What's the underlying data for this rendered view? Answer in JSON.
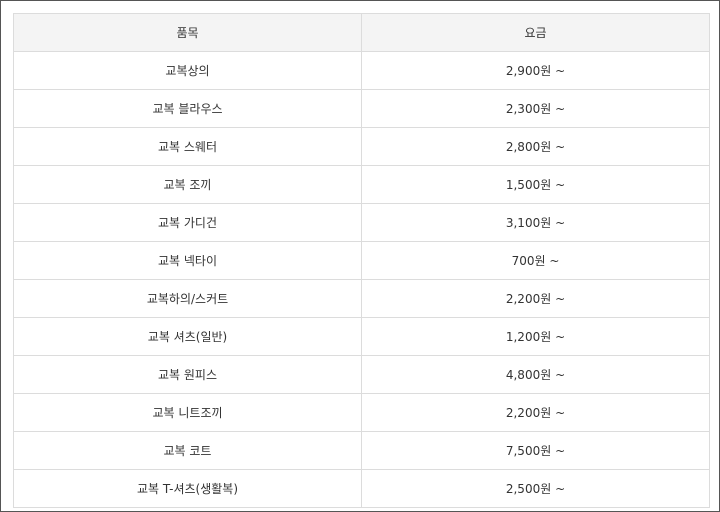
{
  "table": {
    "headers": {
      "item": "품목",
      "price": "요금"
    },
    "rows": [
      {
        "item": "교복상의",
        "price": "2,900원 ~"
      },
      {
        "item": "교복 블라우스",
        "price": "2,300원 ~"
      },
      {
        "item": "교복 스웨터",
        "price": "2,800원 ~"
      },
      {
        "item": "교복 조끼",
        "price": "1,500원 ~"
      },
      {
        "item": "교복 가디건",
        "price": "3,100원 ~"
      },
      {
        "item": "교복 넥타이",
        "price": "700원 ~"
      },
      {
        "item": "교복하의/스커트",
        "price": "2,200원 ~"
      },
      {
        "item": "교복 셔츠(일반)",
        "price": "1,200원 ~"
      },
      {
        "item": "교복 원피스",
        "price": "4,800원 ~"
      },
      {
        "item": "교복 니트조끼",
        "price": "2,200원 ~"
      },
      {
        "item": "교복 코트",
        "price": "7,500원 ~"
      },
      {
        "item": "교복 T-셔츠(생활복)",
        "price": "2,500원 ~"
      }
    ]
  }
}
